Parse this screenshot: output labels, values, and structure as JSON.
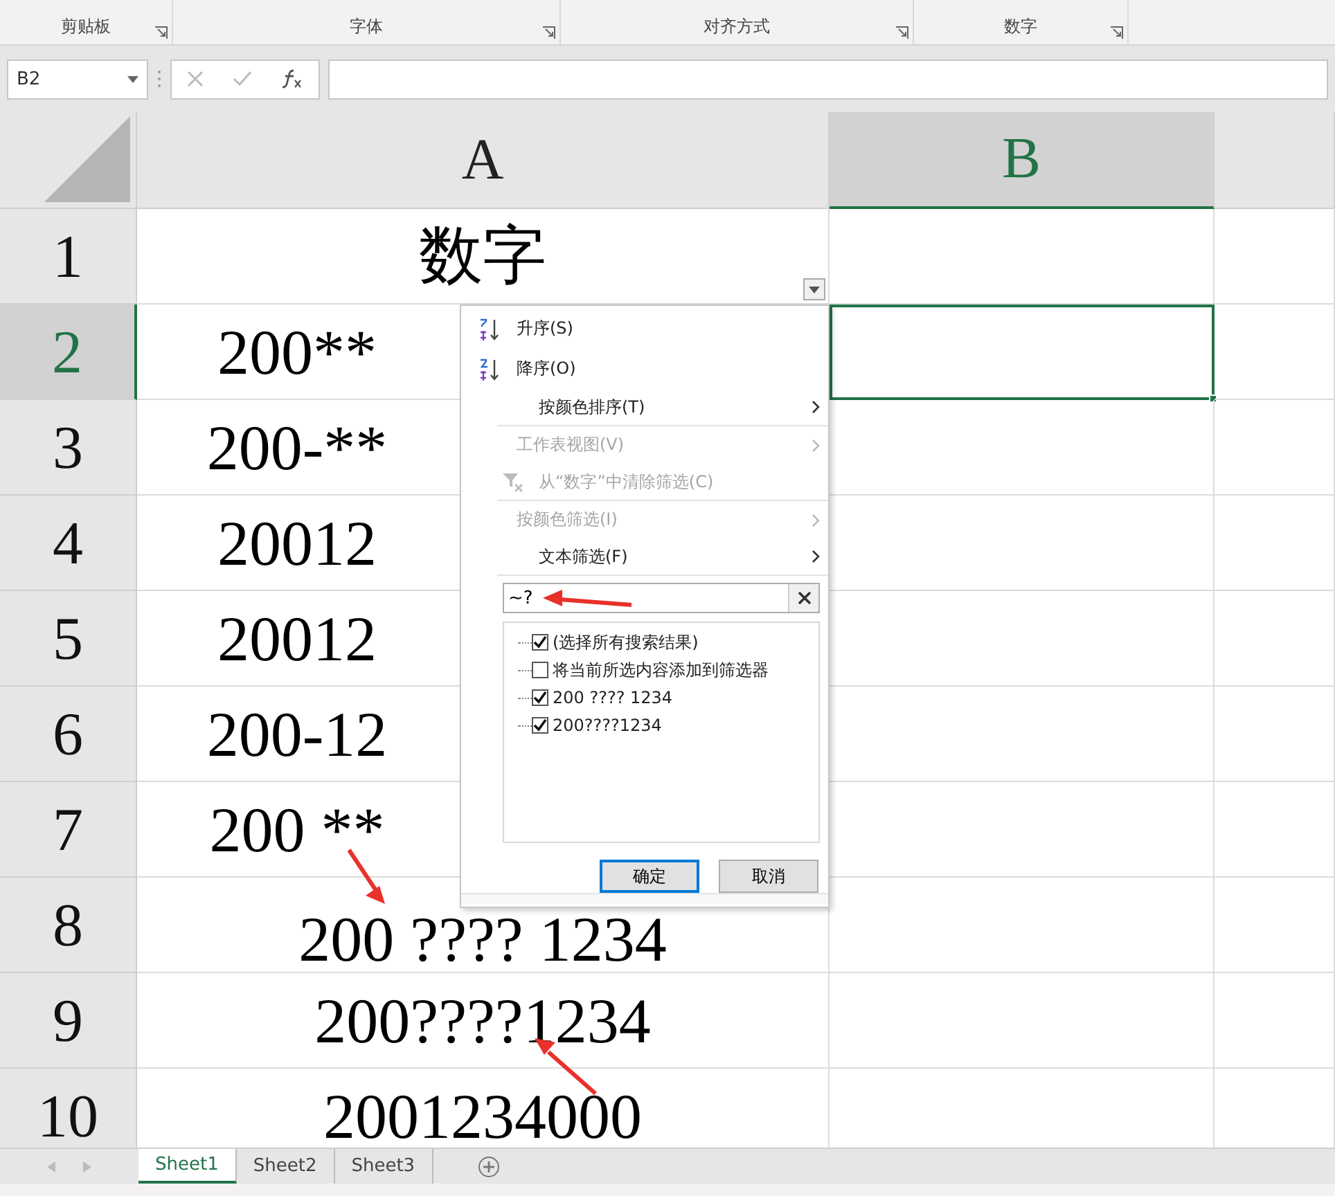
{
  "ribbon_groups": [
    {
      "label": "剪贴板"
    },
    {
      "label": "字体"
    },
    {
      "label": "对齐方式"
    },
    {
      "label": "数字"
    }
  ],
  "name_box": {
    "value": "B2"
  },
  "columns": [
    {
      "label": "A",
      "selected": false
    },
    {
      "label": "B",
      "selected": true
    }
  ],
  "rows": [
    {
      "number": "1",
      "selected": false,
      "a": "数字"
    },
    {
      "number": "2",
      "selected": true,
      "a": "200**"
    },
    {
      "number": "3",
      "selected": false,
      "a": "200-**"
    },
    {
      "number": "4",
      "selected": false,
      "a": "20012"
    },
    {
      "number": "5",
      "selected": false,
      "a": "20012"
    },
    {
      "number": "6",
      "selected": false,
      "a": "200-12"
    },
    {
      "number": "7",
      "selected": false,
      "a": "200 **"
    },
    {
      "number": "8",
      "selected": false,
      "a": "200 ???? 1234"
    },
    {
      "number": "9",
      "selected": false,
      "a": "200????1234"
    },
    {
      "number": "10",
      "selected": false,
      "a": "2001234000"
    }
  ],
  "filter_menu": {
    "items": [
      {
        "kind": "sort-asc",
        "label": "升序(S)",
        "disabled": false,
        "submenu": false
      },
      {
        "kind": "sort-desc",
        "label": "降序(O)",
        "disabled": false,
        "submenu": false
      },
      {
        "kind": "plain",
        "label": "按颜色排序(T)",
        "disabled": false,
        "submenu": true
      },
      {
        "kind": "plain",
        "label": "工作表视图(V)",
        "disabled": true,
        "submenu": true
      },
      {
        "kind": "clear",
        "label": "从“数字”中清除筛选(C)",
        "disabled": true,
        "submenu": false
      },
      {
        "kind": "plain",
        "label": "按颜色筛选(I)",
        "disabled": true,
        "submenu": true
      },
      {
        "kind": "plain",
        "label": "文本筛选(F)",
        "disabled": false,
        "submenu": true
      }
    ],
    "search": {
      "value": "~?"
    },
    "values": [
      {
        "label": "(选择所有搜索结果)",
        "checked": true
      },
      {
        "label": "将当前所选内容添加到筛选器",
        "checked": false
      },
      {
        "label": "200 ???? 1234",
        "checked": true
      },
      {
        "label": "200????1234",
        "checked": true
      }
    ],
    "buttons": [
      {
        "label": "确定",
        "default": true
      },
      {
        "label": "取消",
        "default": false
      }
    ]
  },
  "sheets": [
    {
      "label": "Sheet1",
      "selected": true
    },
    {
      "label": "Sheet2",
      "selected": false
    },
    {
      "label": "Sheet3",
      "selected": false
    }
  ]
}
